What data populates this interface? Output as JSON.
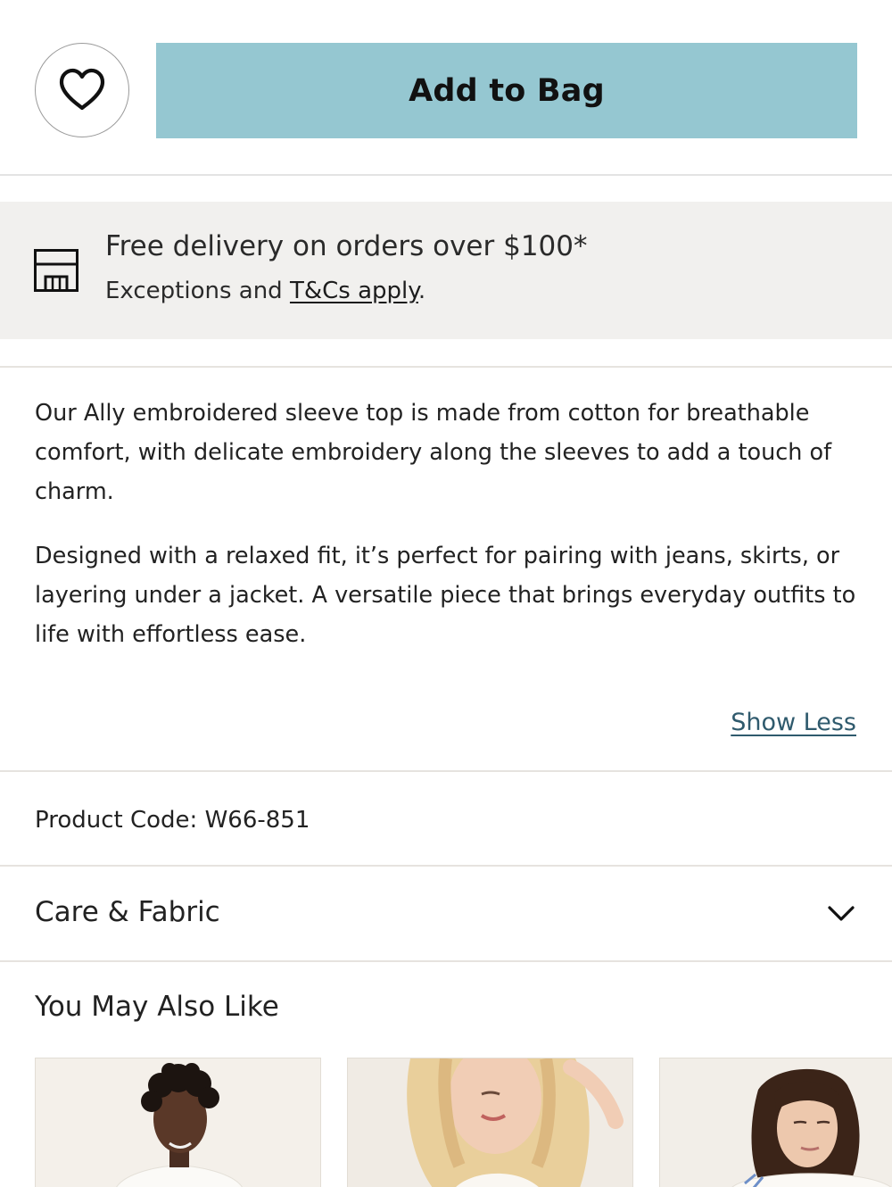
{
  "actions": {
    "wishlist_icon": "heart-outline-icon",
    "add_to_bag_label": "Add to Bag",
    "add_to_bag_color": "#95c7d1"
  },
  "delivery": {
    "icon": "store-icon",
    "title": "Free delivery on orders over $100*",
    "sub_prefix": "Exceptions and ",
    "sub_link": "T&Cs apply",
    "sub_suffix": "."
  },
  "description": {
    "paragraph1": "Our Ally embroidered sleeve top is made from cotton for breathable comfort, with delicate embroidery along the sleeves to add a touch of charm.",
    "paragraph2": "Designed with a relaxed fit, it’s perfect for pairing with jeans, skirts, or layering under a jacket. A versatile piece that brings everyday outfits to life with effortless ease.",
    "toggle_label": "Show Less"
  },
  "product": {
    "code_text": "Product Code: W66-851"
  },
  "care": {
    "label": "Care & Fabric",
    "icon": "chevron-down-icon"
  },
  "recommendations": {
    "title": "You May Also Like",
    "items": [
      {
        "image": "model-curly-dark-hair-white-top"
      },
      {
        "image": "model-blonde-hair-white-top"
      },
      {
        "image": "model-brown-wavy-hair-white-top"
      }
    ]
  }
}
